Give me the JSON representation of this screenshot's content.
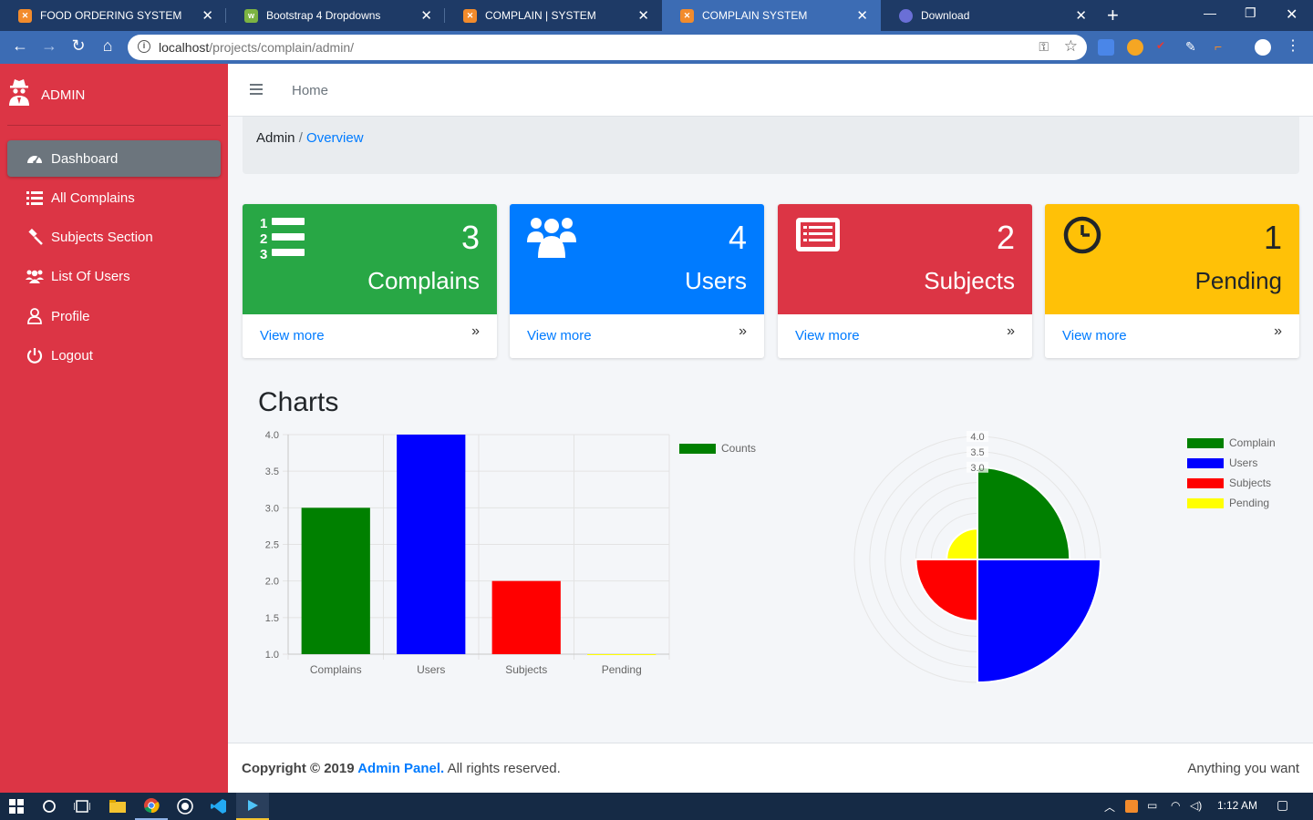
{
  "browser": {
    "tabs": [
      {
        "title": "FOOD ORDERING SYSTEM",
        "active": false
      },
      {
        "title": "Bootstrap 4 Dropdowns",
        "active": false
      },
      {
        "title": "COMPLAIN | SYSTEM",
        "active": false
      },
      {
        "title": "COMPLAIN SYSTEM",
        "active": true
      },
      {
        "title": "Download",
        "active": false
      }
    ],
    "url_host": "localhost",
    "url_path": "/projects/complain/admin/"
  },
  "sidebar": {
    "brand": "ADMIN",
    "items": [
      {
        "label": "Dashboard",
        "icon": "dashboard-icon",
        "active": true
      },
      {
        "label": "All Complains",
        "icon": "list-icon",
        "active": false
      },
      {
        "label": "Subjects Section",
        "icon": "gavel-icon",
        "active": false
      },
      {
        "label": "List Of Users",
        "icon": "users-icon",
        "active": false
      },
      {
        "label": "Profile",
        "icon": "user-icon",
        "active": false
      },
      {
        "label": "Logout",
        "icon": "power-icon",
        "active": false
      }
    ]
  },
  "topnav": {
    "home": "Home"
  },
  "breadcrumb": {
    "root": "Admin",
    "separator": " / ",
    "current": "Overview"
  },
  "cards": [
    {
      "count": "3",
      "title": "Complains",
      "more": "View more",
      "color": "#28a745",
      "icon": "numbered-list-icon"
    },
    {
      "count": "4",
      "title": "Users",
      "more": "View more",
      "color": "#007bff",
      "icon": "users-icon"
    },
    {
      "count": "2",
      "title": "Subjects",
      "more": "View more",
      "color": "#dc3545",
      "icon": "list-alt-icon"
    },
    {
      "count": "1",
      "title": "Pending",
      "more": "View more",
      "color": "#ffc107",
      "icon": "clock-icon"
    }
  ],
  "charts_heading": "Charts",
  "chart_data": [
    {
      "type": "bar",
      "categories": [
        "Complains",
        "Users",
        "Subjects",
        "Pending"
      ],
      "series": [
        {
          "name": "Counts",
          "values": [
            3,
            4,
            2,
            1
          ],
          "color": "green"
        }
      ],
      "colors": [
        "#008000",
        "#0000ff",
        "#ff0000",
        "#ffff00"
      ],
      "ylim": [
        1.0,
        4.0
      ],
      "yticks": [
        "4.0",
        "3.5",
        "3.0",
        "2.5",
        "2.0",
        "1.5",
        "1.0"
      ],
      "grid": true,
      "legend": "top-right"
    },
    {
      "type": "polarArea",
      "labels": [
        "Complain",
        "Users",
        "Subjects",
        "Pending"
      ],
      "values": [
        3,
        4,
        2,
        1
      ],
      "colors": [
        "#008000",
        "#0000ff",
        "#ff0000",
        "#ffff00"
      ],
      "rlim": [
        0,
        4.0
      ],
      "rticks": [
        "4.0",
        "3.5",
        "3.0"
      ],
      "legend": "top-right"
    }
  ],
  "footer": {
    "copy_prefix": "Copyright © 2019 ",
    "brand": "Admin Panel.",
    "copy_suffix": " All rights reserved.",
    "right": "Anything you want"
  },
  "taskbar": {
    "time": "1:12 AM"
  }
}
